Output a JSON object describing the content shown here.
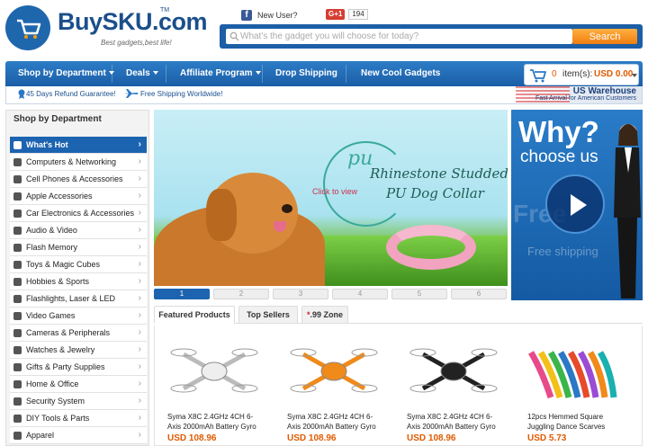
{
  "header": {
    "logo_word": "BuySKU.com",
    "logo_tm": "TM",
    "tagline": "Best gadgets,best life!",
    "fb_glyph": "f",
    "new_user": "New User?",
    "gplus_label": "G+1",
    "gplus_count": "194",
    "search_placeholder": "What's the gadget you will choose for today?",
    "search_button": "Search"
  },
  "nav": {
    "items": [
      {
        "label": "Shop by Department"
      },
      {
        "label": "Deals"
      },
      {
        "label": "Affiliate Program"
      },
      {
        "label": "Drop Shipping"
      },
      {
        "label": "New Cool Gadgets"
      }
    ],
    "cart_count": "0",
    "cart_items_label": "item(s):",
    "cart_total": "USD 0.00"
  },
  "subbar": {
    "guarantee": "45 Days Refund Guarantee!",
    "shipping": "Free Shipping Worldwide!",
    "warehouse_title": "US Warehouse",
    "warehouse_sub": "Fast Arrival for American Customers"
  },
  "sidebar": {
    "title": "Shop by Department",
    "items": [
      {
        "label": "What's Hot",
        "icon": "trophy-icon"
      },
      {
        "label": "Computers & Networking",
        "icon": "computer-icon"
      },
      {
        "label": "Cell Phones & Accessories",
        "icon": "phone-icon"
      },
      {
        "label": "Apple Accessories",
        "icon": "apple-icon"
      },
      {
        "label": "Car Electronics & Accessories",
        "icon": "steering-wheel-icon"
      },
      {
        "label": "Audio & Video",
        "icon": "speaker-icon"
      },
      {
        "label": "Flash Memory",
        "icon": "usb-icon"
      },
      {
        "label": "Toys & Magic Cubes",
        "icon": "paw-icon"
      },
      {
        "label": "Hobbies & Sports",
        "icon": "dumbbell-icon"
      },
      {
        "label": "Flashlights, Laser & LED",
        "icon": "flashlight-icon"
      },
      {
        "label": "Video Games",
        "icon": "gamepad-icon"
      },
      {
        "label": "Cameras & Peripherals",
        "icon": "camera-icon"
      },
      {
        "label": "Watches & Jewelry",
        "icon": "watch-icon"
      },
      {
        "label": "Gifts & Party Supplies",
        "icon": "gift-icon"
      },
      {
        "label": "Home & Office",
        "icon": "home-icon"
      },
      {
        "label": "Security System",
        "icon": "security-icon"
      },
      {
        "label": "DIY Tools & Parts",
        "icon": "tools-icon"
      },
      {
        "label": "Apparel",
        "icon": "shirt-icon"
      }
    ]
  },
  "banner": {
    "pu": "pu",
    "title_line1": "Rhinestone Studded",
    "title_line2": "PU Dog Collar",
    "click": "Click to view",
    "pages": [
      "1",
      "2",
      "3",
      "4",
      "5",
      "6"
    ],
    "active_page": "1"
  },
  "promo": {
    "why": "Why?",
    "choose": "choose us",
    "watermark_free": "Free",
    "watermark_shipping": "Free shipping"
  },
  "tabs": {
    "featured": "Featured Products",
    "best": "Top Sellers",
    "zone_mark": "*",
    "zone": ".99 Zone"
  },
  "products": [
    {
      "name": "Syma X8C 2.4GHz 4CH 6-Axis 2000mAh Battery Gyro",
      "price": "USD 108.96",
      "color": "#ffffff"
    },
    {
      "name": "Syma X8C 2.4GHz 4CH 6-Axis 2000mAh Battery Gyro",
      "price": "USD 108.96",
      "color": "#f08a1a"
    },
    {
      "name": "Syma X8C 2.4GHz 4CH 6-Axis 2000mAh Battery Gyro",
      "price": "USD 108.96",
      "color": "#222222"
    },
    {
      "name": "12pcs Hemmed Square Juggling Dance Scarves",
      "price": "USD 5.73",
      "color": "#e84b8a"
    }
  ],
  "colors": {
    "brand_blue": "#1c64b0",
    "price_orange": "#e05a00"
  }
}
